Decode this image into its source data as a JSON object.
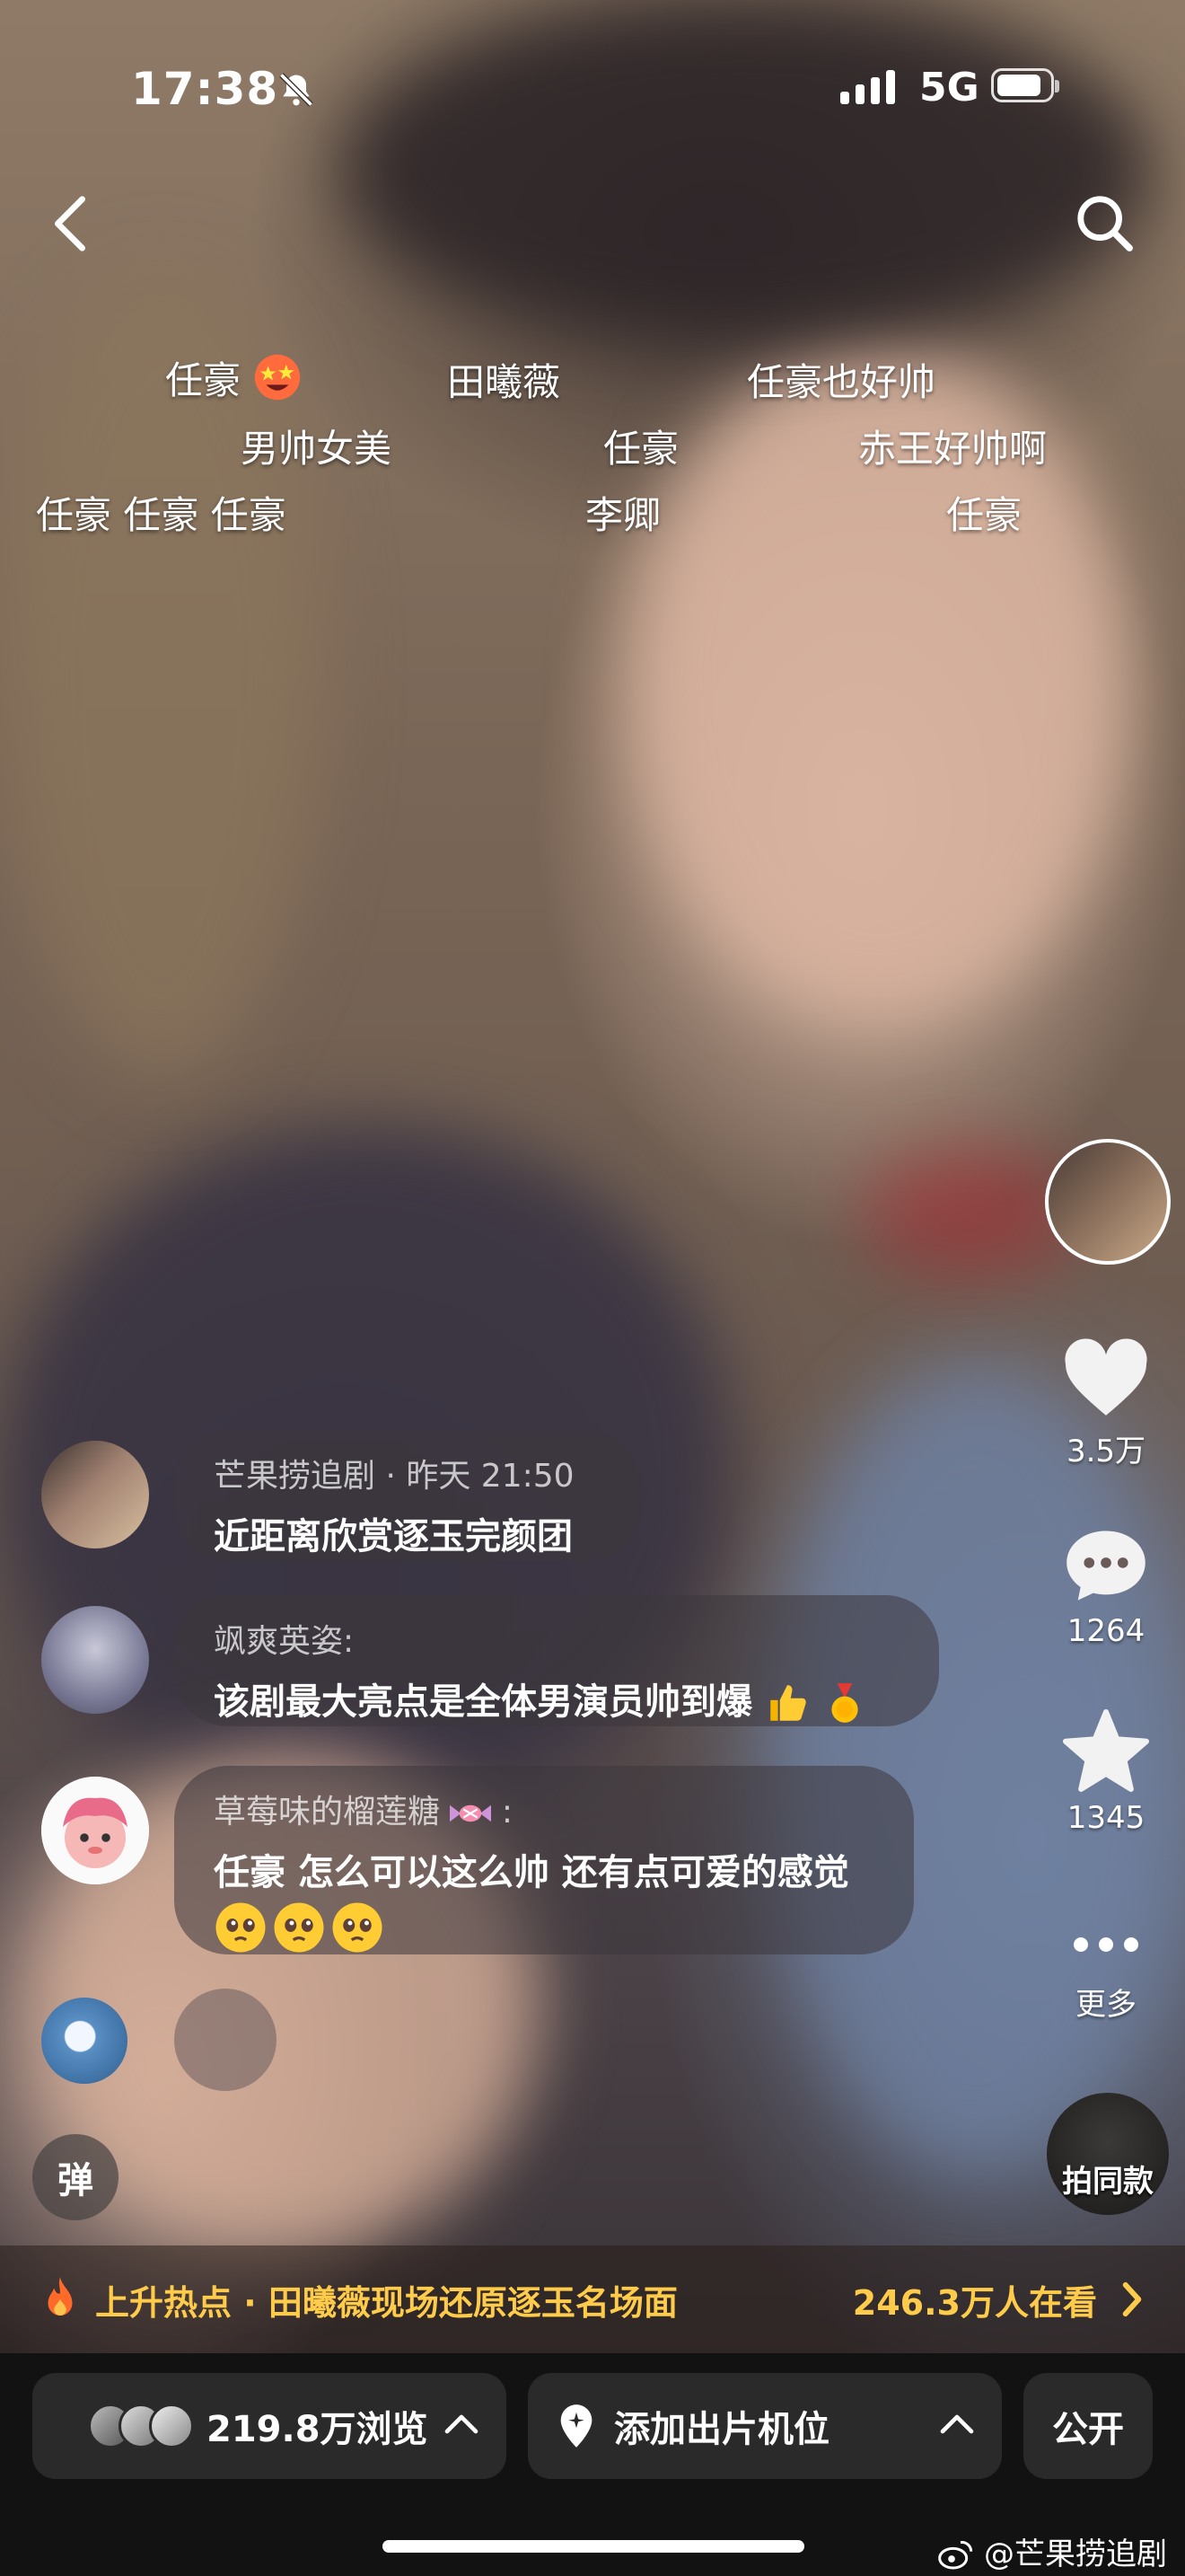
{
  "status_bar": {
    "time": "17:38",
    "network": "5G"
  },
  "danmaku": [
    {
      "text": "任豪",
      "emoji": true
    },
    {
      "text": "田曦薇"
    },
    {
      "text": "任豪也好帅"
    },
    {
      "text": "男帅女美"
    },
    {
      "text": "任豪"
    },
    {
      "text": "赤王好帅啊"
    },
    {
      "text": "任豪 任豪 任豪"
    },
    {
      "text": "李卿"
    },
    {
      "text": "任豪"
    }
  ],
  "right_rail": {
    "like_count": "3.5万",
    "comment_count": "1264",
    "favorite_count": "1345",
    "more_label": "更多",
    "same_style_label": "拍同款"
  },
  "comments": [
    {
      "name": "芒果捞追剧",
      "time": "· 昨天 21:50",
      "text": "近距离欣赏逐玉完颜团"
    },
    {
      "name": "飒爽英姿:",
      "text": "该剧最大亮点是全体男演员帅到爆",
      "emojis": [
        "thumbs-up",
        "medal"
      ]
    },
    {
      "name": "草莓味的榴莲糖",
      "name_suffix": ":",
      "text": "任豪 怎么可以这么帅 还有点可爱的感觉",
      "emojis": [
        "pleading-face",
        "pleading-face",
        "pleading-face"
      ]
    }
  ],
  "danmu_button_label": "弹",
  "hot_bar": {
    "text": "上升热点 · 田曦薇现场还原逐玉名场面",
    "viewers": "246.3万人在看"
  },
  "bottom_bar": {
    "views": "219.8万浏览",
    "location": "添加出片机位",
    "visibility": "公开"
  },
  "watermark": "@芒果捞追剧"
}
